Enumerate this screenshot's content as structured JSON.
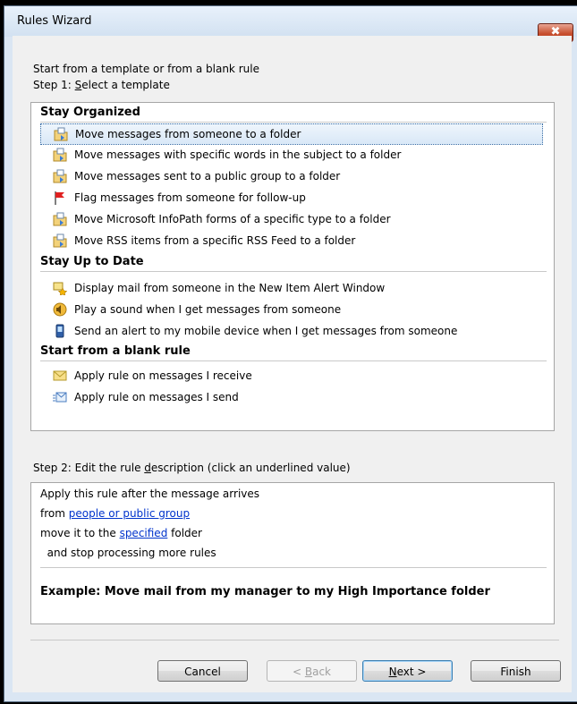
{
  "window": {
    "title": "Rules Wizard",
    "close_glyph": "✖"
  },
  "intro": "Start from a template or from a blank rule",
  "step1": {
    "prefix": "Step 1: ",
    "mnemonic": "S",
    "rest": "elect a template"
  },
  "groups": {
    "organized": {
      "heading": "Stay Organized",
      "items": [
        {
          "label": "Move messages from someone to a folder",
          "icon": "folder-move-icon",
          "selected": true
        },
        {
          "label": "Move messages with specific words in the subject to a folder",
          "icon": "folder-move-icon"
        },
        {
          "label": "Move messages sent to a public group to a folder",
          "icon": "folder-move-icon"
        },
        {
          "label": "Flag messages from someone for follow-up",
          "icon": "red-flag-icon"
        },
        {
          "label": "Move Microsoft InfoPath forms of a specific type to a folder",
          "icon": "folder-move-icon"
        },
        {
          "label": "Move RSS items from a specific RSS Feed to a folder",
          "icon": "folder-move-icon"
        }
      ]
    },
    "uptodate": {
      "heading": "Stay Up to Date",
      "items": [
        {
          "label": "Display mail from someone in the New Item Alert Window",
          "icon": "alert-window-icon"
        },
        {
          "label": "Play a sound when I get messages from someone",
          "icon": "sound-icon"
        },
        {
          "label": "Send an alert to my mobile device when I get messages from someone",
          "icon": "mobile-device-icon"
        }
      ]
    },
    "blank": {
      "heading": "Start from a blank rule",
      "items": [
        {
          "label": "Apply rule on messages I receive",
          "icon": "envelope-icon"
        },
        {
          "label": "Apply rule on messages I send",
          "icon": "send-mail-icon"
        }
      ]
    }
  },
  "step2": {
    "prefix": "Step 2: Edit the rule ",
    "mnemonic": "d",
    "rest": "escription (click an underlined value)"
  },
  "description": {
    "line1": "Apply this rule after the message arrives",
    "line2_prefix": "from ",
    "line2_link": "people or public group",
    "line3_prefix": "move it to the ",
    "line3_link": "specified",
    "line3_suffix": " folder",
    "line4": "  and stop processing more rules",
    "example": "Example: Move mail from my manager to my High Importance folder"
  },
  "buttons": {
    "cancel": "Cancel",
    "back_prefix": "< ",
    "back_mnemonic": "B",
    "back_rest": "ack",
    "next_mnemonic": "N",
    "next_rest": "ext >",
    "finish": "Finish"
  }
}
